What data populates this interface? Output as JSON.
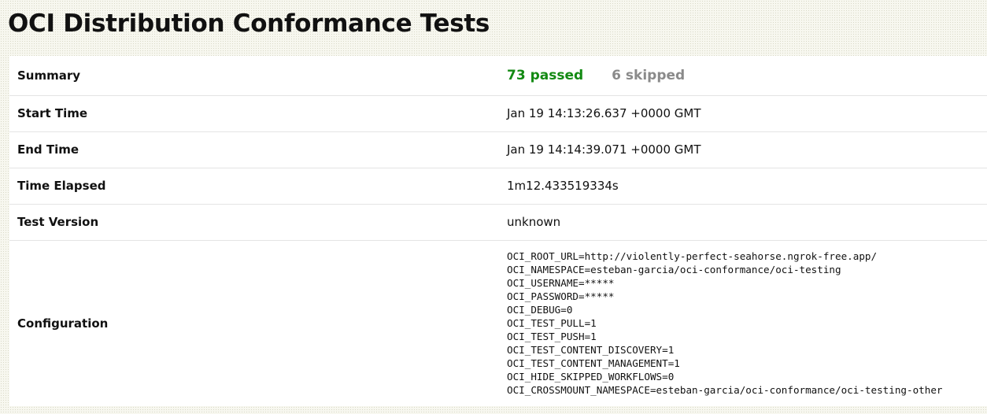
{
  "title": "OCI Distribution Conformance Tests",
  "rows": {
    "summary": {
      "label": "Summary",
      "passed": "73 passed",
      "skipped": "6 skipped"
    },
    "start_time": {
      "label": "Start Time",
      "value": "Jan 19 14:13:26.637 +0000 GMT"
    },
    "end_time": {
      "label": "End Time",
      "value": "Jan 19 14:14:39.071 +0000 GMT"
    },
    "time_elapsed": {
      "label": "Time Elapsed",
      "value": "1m12.433519334s"
    },
    "test_version": {
      "label": "Test Version",
      "value": "unknown"
    },
    "configuration": {
      "label": "Configuration",
      "lines": [
        "OCI_ROOT_URL=http://violently-perfect-seahorse.ngrok-free.app/",
        "OCI_NAMESPACE=esteban-garcia/oci-conformance/oci-testing",
        "OCI_USERNAME=*****",
        "OCI_PASSWORD=*****",
        "OCI_DEBUG=0",
        "OCI_TEST_PULL=1",
        "OCI_TEST_PUSH=1",
        "OCI_TEST_CONTENT_DISCOVERY=1",
        "OCI_TEST_CONTENT_MANAGEMENT=1",
        "OCI_HIDE_SKIPPED_WORKFLOWS=0",
        "OCI_CROSSMOUNT_NAMESPACE=esteban-garcia/oci-conformance/oci-testing-other"
      ]
    }
  },
  "colors": {
    "passed": "#138a13",
    "skipped": "#8a8a8a",
    "background": "#f7f7ef"
  }
}
